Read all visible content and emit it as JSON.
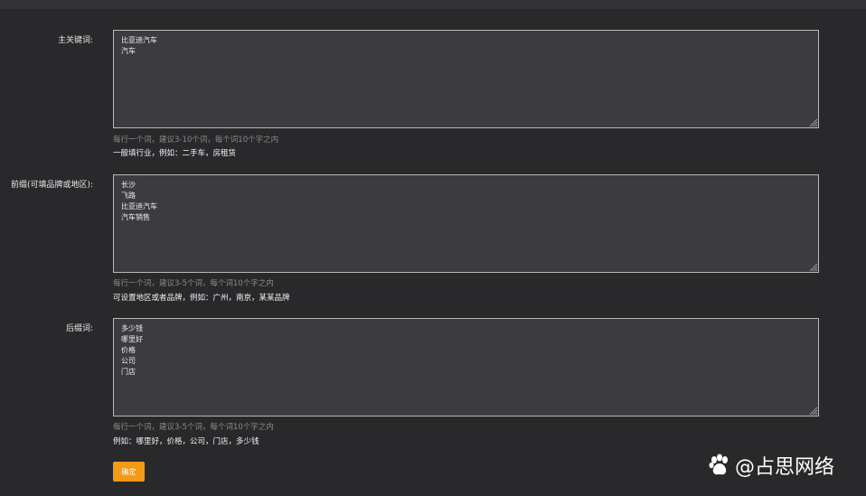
{
  "form": {
    "main_keywords": {
      "label": "主关键词:",
      "value": "比亚迪汽车\n汽车",
      "hint": "每行一个词，建议3-10个词，每个词10个字之内",
      "description": "一般填行业，例如：二手车，房租赁"
    },
    "prefix_words": {
      "label": "前缀(可填品牌或地区):",
      "value": "长沙\n飞路\n比亚迪汽车\n汽车销售",
      "hint": "每行一个词，建议3-5个词，每个词10个字之内",
      "description": "可设置地区或者品牌，例如：广州，南京，某某品牌"
    },
    "suffix_words": {
      "label": "后缀词:",
      "value": "多少钱\n哪里好\n价格\n公司\n门店",
      "hint": "每行一个词，建议3-5个词，每个词10个字之内",
      "description": "例如：哪里好，价格，公司，门店，多少钱"
    },
    "confirm_label": "确定"
  },
  "watermark": {
    "text": "@占思网络",
    "icon": "paw-icon"
  }
}
